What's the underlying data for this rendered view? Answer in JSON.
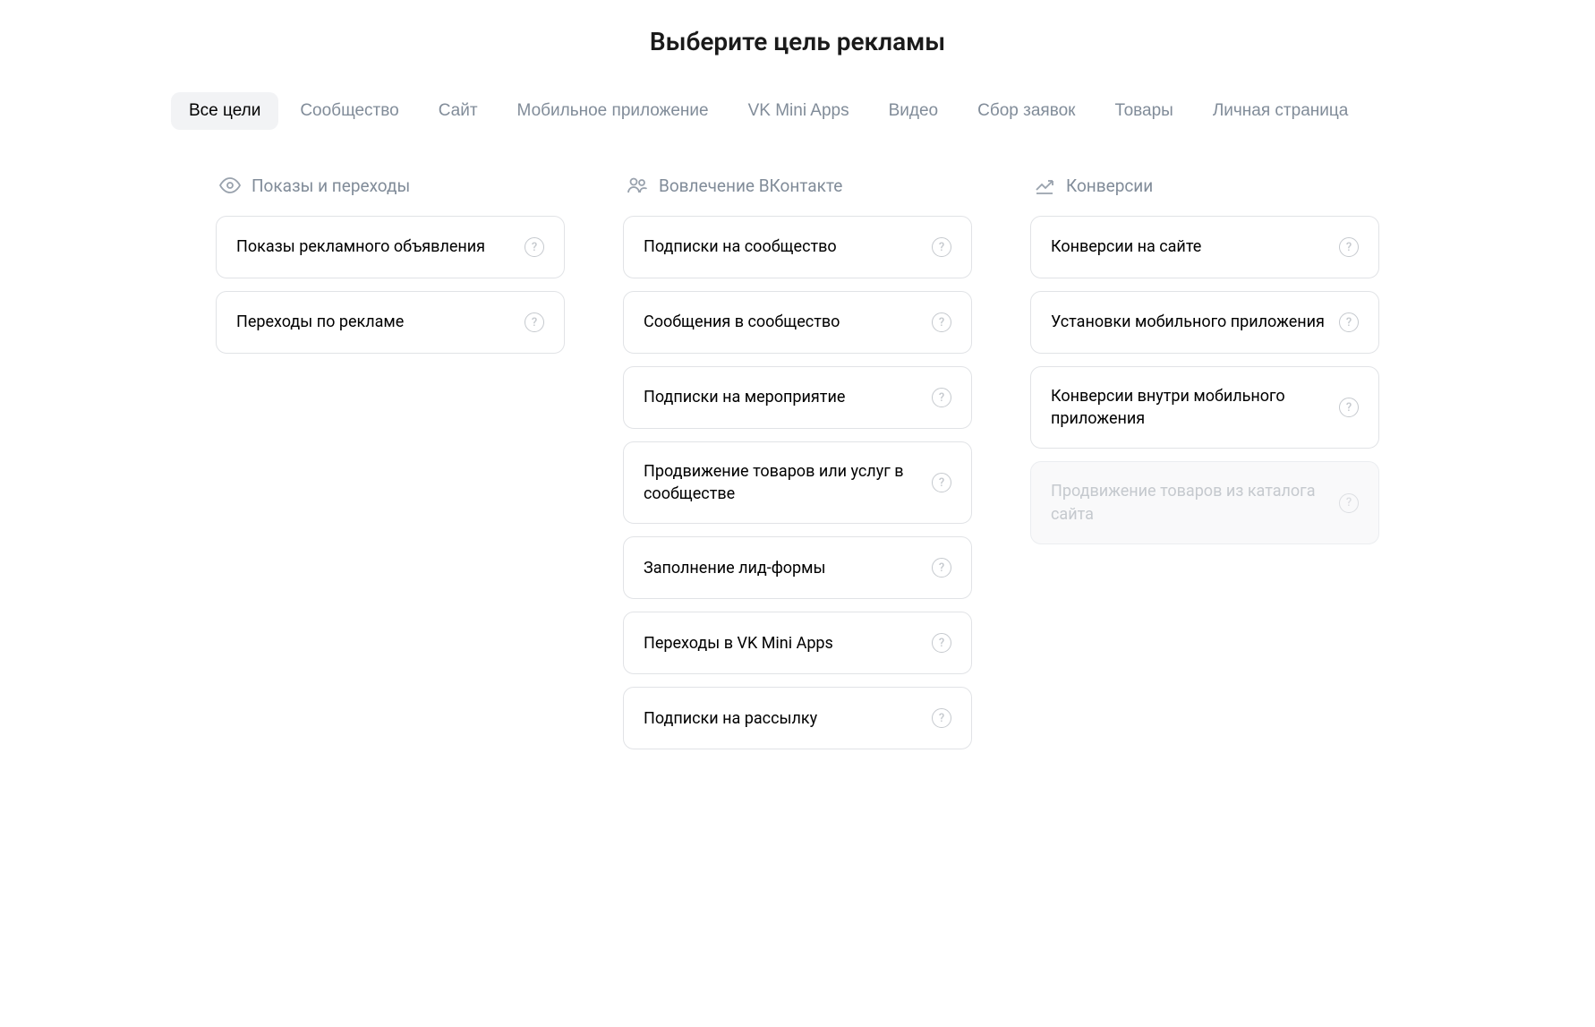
{
  "page_title": "Выберите цель рекламы",
  "tabs": [
    {
      "label": "Все цели",
      "active": true
    },
    {
      "label": "Сообщество",
      "active": false
    },
    {
      "label": "Сайт",
      "active": false
    },
    {
      "label": "Мобильное приложение",
      "active": false
    },
    {
      "label": "VK Mini Apps",
      "active": false
    },
    {
      "label": "Видео",
      "active": false
    },
    {
      "label": "Сбор заявок",
      "active": false
    },
    {
      "label": "Товары",
      "active": false
    },
    {
      "label": "Личная страница",
      "active": false
    }
  ],
  "columns": [
    {
      "title": "Показы и переходы",
      "icon": "eye-icon",
      "cards": [
        {
          "label": "Показы рекламного объявления",
          "disabled": false
        },
        {
          "label": "Переходы по рекламе",
          "disabled": false
        }
      ]
    },
    {
      "title": "Вовлечение ВКонтакте",
      "icon": "users-icon",
      "cards": [
        {
          "label": "Подписки на сообщество",
          "disabled": false
        },
        {
          "label": "Сообщения в сообщество",
          "disabled": false
        },
        {
          "label": "Подписки на мероприятие",
          "disabled": false
        },
        {
          "label": "Продвижение товаров или услуг в сообществе",
          "disabled": false
        },
        {
          "label": "Заполнение лид-формы",
          "disabled": false
        },
        {
          "label": "Переходы в VK Mini Apps",
          "disabled": false
        },
        {
          "label": "Подписки на рассылку",
          "disabled": false
        }
      ]
    },
    {
      "title": "Конверсии",
      "icon": "trend-icon",
      "cards": [
        {
          "label": "Конверсии на сайте",
          "disabled": false
        },
        {
          "label": "Установки мобильного приложения",
          "disabled": false
        },
        {
          "label": "Конверсии внутри мобильного приложения",
          "disabled": false
        },
        {
          "label": "Продвижение товаров из каталога сайта",
          "disabled": true
        }
      ]
    }
  ]
}
